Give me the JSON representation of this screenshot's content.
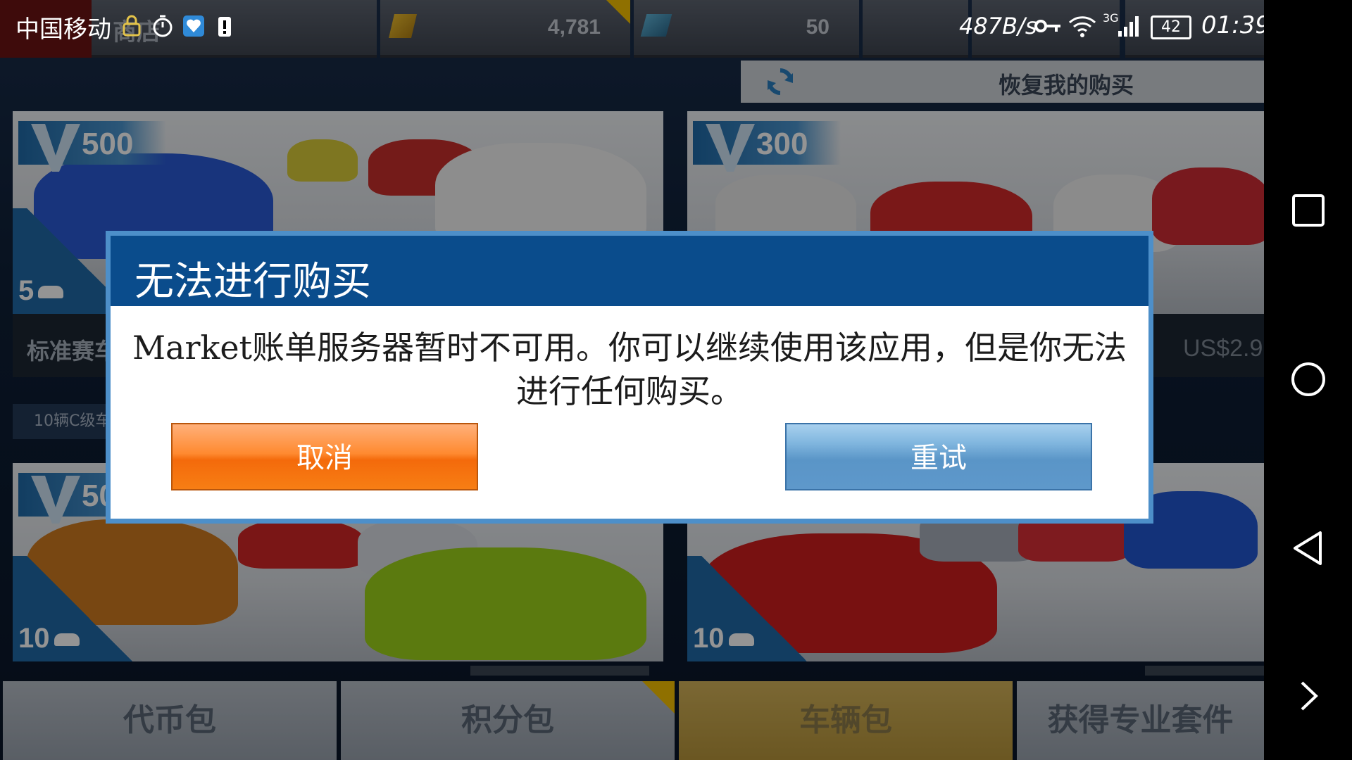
{
  "status_bar": {
    "carrier": "中国移动",
    "net_speed": "487B/s",
    "network": "3G",
    "battery": "42",
    "time": "01:39"
  },
  "top_bar": {
    "shop_label": "商店",
    "coins": "4,781",
    "tokens": "50"
  },
  "restore": {
    "label": "恢复我的购买"
  },
  "cards": [
    {
      "tokens": "500",
      "count": "5",
      "footer": "标准赛车"
    },
    {
      "tokens": "300",
      "price": "US$2.9"
    },
    {
      "tokens": "500",
      "count": "10",
      "subheader": "10辆C级车"
    },
    {
      "count": "10"
    }
  ],
  "bottom_tabs": [
    {
      "label": "代币包"
    },
    {
      "label": "积分包"
    },
    {
      "label": "车辆包"
    },
    {
      "label": "获得专业套件"
    }
  ],
  "dialog": {
    "title": "无法进行购买",
    "message": "Market账单服务器暂时不可用。你可以继续使用该应用，但是你无法进行任何购买。",
    "cancel_label": "取消",
    "retry_label": "重试"
  },
  "colors": {
    "dialog_header": "#0a4c8c",
    "cancel_button": "#f77e14",
    "retry_button": "#5e98cb"
  },
  "nav": {
    "icons": [
      "recents-icon",
      "home-icon",
      "back-icon",
      "expand-icon"
    ]
  }
}
